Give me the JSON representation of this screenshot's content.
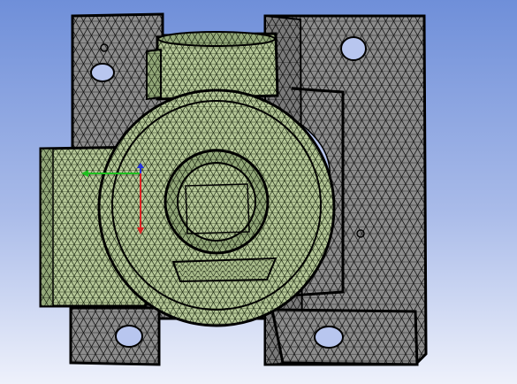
{
  "viewport": {
    "background_top": "#6f8fd9",
    "background_bottom": "#eef1fb"
  },
  "model": {
    "body_color": "#8c8c8c",
    "body_mesh_color": "#1a1a1a",
    "highlight_color": "#b7c99a",
    "highlight_mesh_color": "#233015",
    "hole_color": "#b8c6ef",
    "edge_color": "#000000"
  },
  "triad": {
    "axes": [
      {
        "name": "x-axis",
        "color": "#1fbf1f"
      },
      {
        "name": "y-axis",
        "color": "#2233dd"
      },
      {
        "name": "z-axis",
        "color": "#dd2222"
      }
    ]
  }
}
